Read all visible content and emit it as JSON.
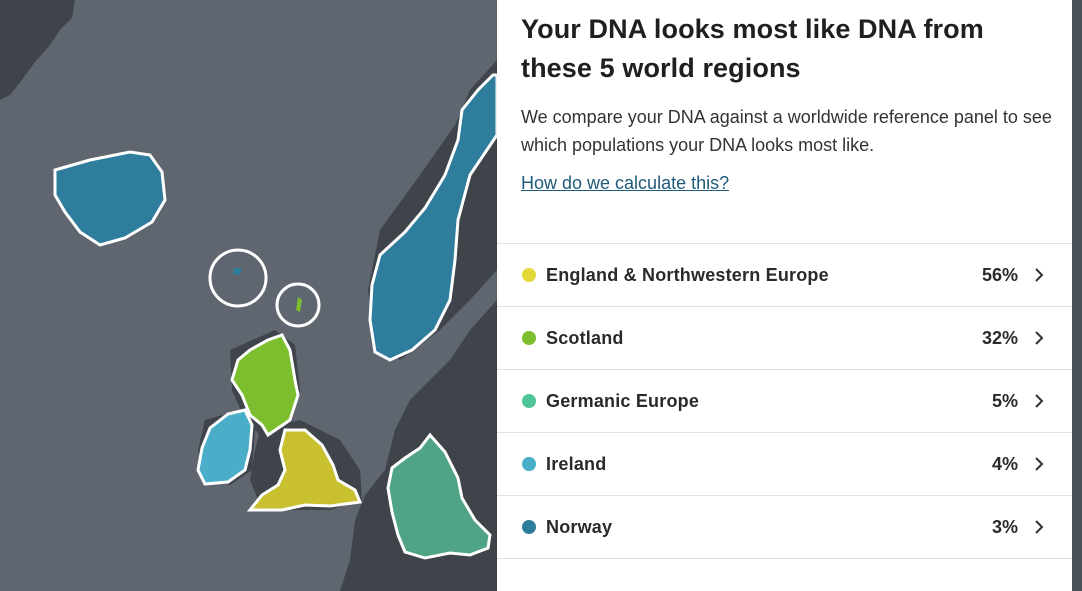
{
  "panel": {
    "title": "Your DNA looks most like DNA from these 5 world regions",
    "description": "We compare your DNA against a worldwide reference panel to see which populations your DNA looks most like.",
    "link_label": "How do we calculate this?"
  },
  "regions": [
    {
      "name": "England & Northwestern Europe",
      "percent": "56%",
      "color": "#e3d93a",
      "icon": "chevron-right-icon"
    },
    {
      "name": "Scotland",
      "percent": "32%",
      "color": "#7cbf2e",
      "icon": "chevron-right-icon"
    },
    {
      "name": "Germanic Europe",
      "percent": "5%",
      "color": "#4fc497",
      "icon": "chevron-right-icon"
    },
    {
      "name": "Ireland",
      "percent": "4%",
      "color": "#4aaec9",
      "icon": "chevron-right-icon"
    },
    {
      "name": "Norway",
      "percent": "3%",
      "color": "#2f7d9c",
      "icon": "chevron-right-icon"
    }
  ],
  "map": {
    "water_color": "#5f6670",
    "land_color": "#3f444b",
    "outline_color": "#ffffff"
  }
}
